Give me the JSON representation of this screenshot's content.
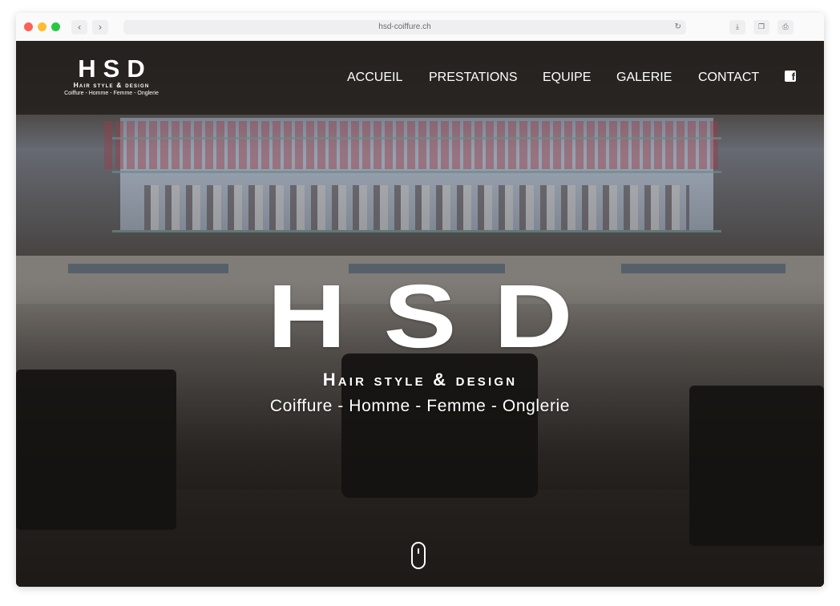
{
  "browser": {
    "url": "hsd-coiffure.ch",
    "reload_glyph": "↻",
    "back_glyph": "‹",
    "forward_glyph": "›",
    "tools": [
      "download-icon",
      "copy-icon",
      "print-icon"
    ]
  },
  "header": {
    "logo": {
      "title": "HSD",
      "subtitle": "Hair style & design",
      "tagline": "Coiffure - Homme - Femme - Onglerie"
    },
    "nav": [
      {
        "label": "ACCUEIL"
      },
      {
        "label": "PRESTATIONS"
      },
      {
        "label": "EQUIPE"
      },
      {
        "label": "GALERIE"
      },
      {
        "label": "CONTACT"
      }
    ],
    "social_icon": "facebook-icon",
    "social_glyph": "f"
  },
  "hero": {
    "title": "HSD",
    "subtitle": "Hair style & design",
    "tagline": "Coiffure - Homme - Femme - Onglerie",
    "scroll_icon": "mouse-scroll-icon"
  },
  "colors": {
    "header_bg": "#201c19",
    "text": "#ffffff"
  }
}
